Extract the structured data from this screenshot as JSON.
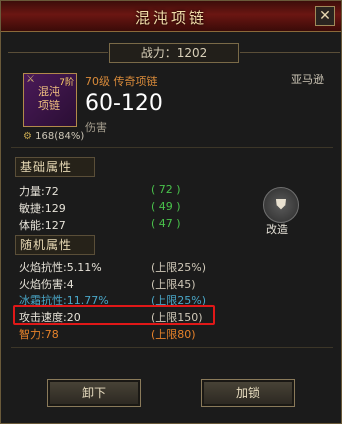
{
  "title": "混沌项链",
  "close_label": "✕",
  "power": "战力：1202",
  "item": {
    "icon_text": "混沌项链",
    "grade": "7阶",
    "level_rarity": "70级  传奇项链",
    "type": "亚马逊",
    "damage": "60-120",
    "damage_label": "伤害",
    "durability": "168(84%)"
  },
  "base_section": {
    "title": "基础属性",
    "rows": [
      {
        "label": "力量:72",
        "value": "( 72 )"
      },
      {
        "label": "敏捷:129",
        "value": "( 49 )"
      },
      {
        "label": "体能:127",
        "value": "( 47 )"
      }
    ]
  },
  "reform": {
    "label": "改造"
  },
  "random_section": {
    "title": "随机属性",
    "rows": [
      {
        "label": "火焰抗性:5.11%",
        "value": "(上限25%)"
      },
      {
        "label": "火焰伤害:4",
        "value": "(上限45)"
      },
      {
        "label": "冰霜抗性:11.77%",
        "value": "(上限25%)"
      },
      {
        "label": "攻击速度:20",
        "value": "(上限150)"
      },
      {
        "label": "智力:78",
        "value": "(上限80)"
      }
    ]
  },
  "buttons": {
    "unequip": "卸下",
    "add_lock": "加锁"
  },
  "colors": {
    "title_bar": "#6b1612",
    "highlight_box": "#e01818",
    "green": "#49c24b",
    "blue": "#4aa7c8",
    "orange": "#e6822a"
  }
}
